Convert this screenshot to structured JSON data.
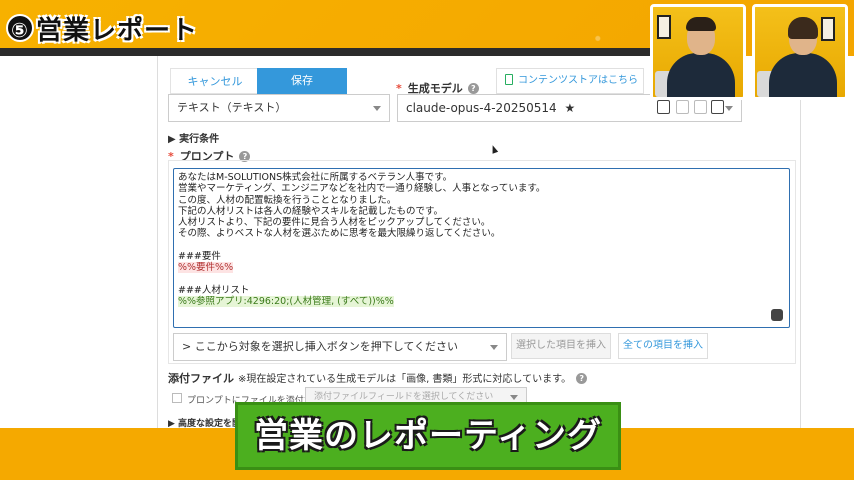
{
  "overlay": {
    "title_number": "⑤",
    "title_text": "営業レポート",
    "caption": "営業のレポーティング"
  },
  "form": {
    "cancel_label": "キャンセル",
    "save_label": "保存",
    "model_label": "生成モデル",
    "store_link": "コンテンツストアはこちら >",
    "output_type_value": "テキスト（テキスト）",
    "model_value": "claude-opus-4-20250514",
    "model_star": "★",
    "exec_conditions": "▶ 実行条件",
    "prompt_label": "プロンプト",
    "prompt_lines": [
      "あなたはM-SOLUTIONS株式会社に所属するベテラン人事です。",
      "営業やマーケティング、エンジニアなどを社内で一通り経験し、人事となっています。",
      "この度、人材の配置転換を行うこととなりました。",
      "下記の人材リストは各人の経験やスキルを記載したものです。",
      "人材リストより、下記の要件に見合う人材をピックアップしてください。",
      "その際、よりベストな人材を選ぶために思考を最大限繰り返してください。",
      "",
      "###要件",
      "%%要件%%",
      "",
      "###人材リスト",
      "%%参照アプリ:4296:20;(人材管理, (すべて))%%"
    ],
    "insert_select_placeholder": "> ここから対象を選択し挿入ボタンを押下してください",
    "insert_selected_label": "選択した項目を挿入",
    "insert_all_label": "全ての項目を挿入",
    "attach_label": "添付ファイル",
    "attach_note": "※現在設定されている生成モデルは「画像, 書類」形式に対応しています。",
    "attach_checkbox_label": "プロンプトにファイルを添付する",
    "attach_field_placeholder": "添付ファイルフィールドを選択してください",
    "advanced_label": "▶ 高度な設定を開"
  },
  "colors": {
    "accent": "#3498db",
    "required": "#e74c3c",
    "caption_bg": "#4caf1f",
    "frame": "#f5a900"
  }
}
